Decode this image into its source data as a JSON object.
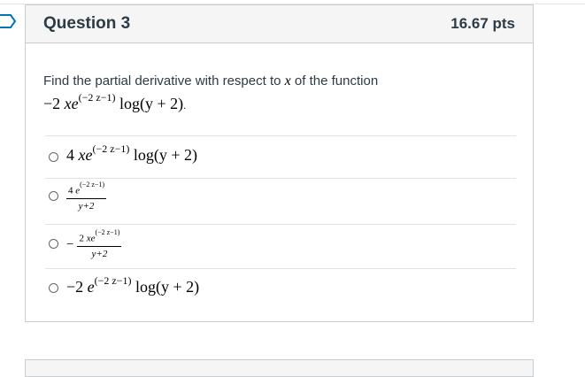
{
  "question": {
    "title": "Question 3",
    "points": "16.67 pts",
    "prompt_prefix": "Find the partial derivative with respect to",
    "prompt_var": "x",
    "prompt_suffix": "of the function",
    "function": {
      "lead": "−2 ",
      "xe": "xe",
      "exponent": "(−2 z−1)",
      "tail": " log(y + 2)",
      "period": "."
    }
  },
  "answers": [
    {
      "lead": "4 ",
      "xe": "xe",
      "exponent": "(−2 z−1)",
      "tail": " log(y + 2)"
    },
    {
      "numerator_lead": "4 ",
      "numerator_e": "e",
      "numerator_exp": "(−2 z−1)",
      "denominator": "y+2"
    },
    {
      "sign": "−",
      "numerator_lead": "2 ",
      "numerator_e": "xe",
      "numerator_exp": "(−2 z−1)",
      "denominator": "y+2"
    },
    {
      "lead": "−2 ",
      "xe": "e",
      "exponent": "(−2 z−1)",
      "tail": " log(y + 2)"
    }
  ],
  "colors": {
    "header_bg": "#f5f5f5",
    "border": "#c7cdd1",
    "text": "#2d3b45",
    "flag": "#0374b5"
  },
  "icons": {
    "flag": "bookmark-flag-icon",
    "radio": "radio-circle-icon"
  }
}
